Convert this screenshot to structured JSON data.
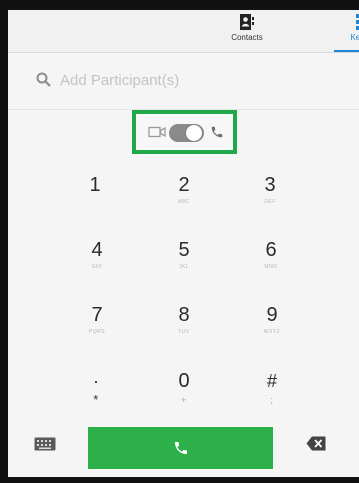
{
  "tabs": {
    "contacts_label": "Contacts",
    "keypad_label": "Keypad"
  },
  "search": {
    "placeholder": "Add Participant(s)"
  },
  "mode_toggle": {
    "left_icon": "video-icon",
    "right_icon": "phone-icon",
    "state": "audio"
  },
  "keypad": {
    "keys": [
      {
        "digit": "1",
        "letters": ""
      },
      {
        "digit": "2",
        "letters": "ABC"
      },
      {
        "digit": "3",
        "letters": "DEF"
      },
      {
        "digit": "4",
        "letters": "GHI"
      },
      {
        "digit": "5",
        "letters": "JKL"
      },
      {
        "digit": "6",
        "letters": "MNO"
      },
      {
        "digit": "7",
        "letters": "PQRS"
      },
      {
        "digit": "8",
        "letters": "TUV"
      },
      {
        "digit": "9",
        "letters": "WXYZ"
      },
      {
        "digit": "·",
        "letters": "*"
      },
      {
        "digit": "0",
        "letters": "+"
      },
      {
        "digit": "#",
        "letters": ";"
      }
    ]
  },
  "colors": {
    "accent_blue": "#1e88d8",
    "call_green": "#2db04a",
    "highlight_green": "#20a84a"
  },
  "bottom": {
    "keyboard_icon": "keyboard-icon",
    "call_icon": "phone-icon",
    "delete_icon": "backspace-icon"
  }
}
